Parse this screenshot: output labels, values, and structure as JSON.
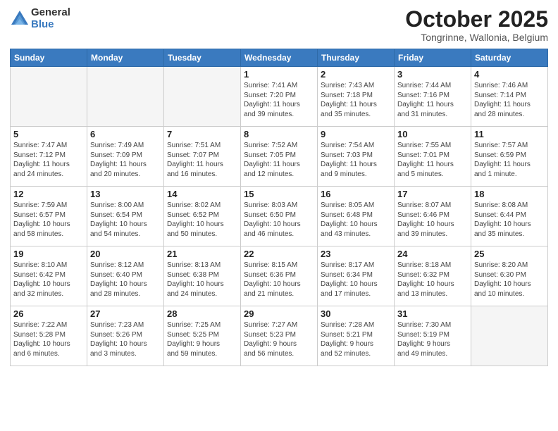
{
  "logo": {
    "general": "General",
    "blue": "Blue"
  },
  "header": {
    "title": "October 2025",
    "location": "Tongrinne, Wallonia, Belgium"
  },
  "weekdays": [
    "Sunday",
    "Monday",
    "Tuesday",
    "Wednesday",
    "Thursday",
    "Friday",
    "Saturday"
  ],
  "weeks": [
    [
      {
        "day": "",
        "info": ""
      },
      {
        "day": "",
        "info": ""
      },
      {
        "day": "",
        "info": ""
      },
      {
        "day": "1",
        "info": "Sunrise: 7:41 AM\nSunset: 7:20 PM\nDaylight: 11 hours\nand 39 minutes."
      },
      {
        "day": "2",
        "info": "Sunrise: 7:43 AM\nSunset: 7:18 PM\nDaylight: 11 hours\nand 35 minutes."
      },
      {
        "day": "3",
        "info": "Sunrise: 7:44 AM\nSunset: 7:16 PM\nDaylight: 11 hours\nand 31 minutes."
      },
      {
        "day": "4",
        "info": "Sunrise: 7:46 AM\nSunset: 7:14 PM\nDaylight: 11 hours\nand 28 minutes."
      }
    ],
    [
      {
        "day": "5",
        "info": "Sunrise: 7:47 AM\nSunset: 7:12 PM\nDaylight: 11 hours\nand 24 minutes."
      },
      {
        "day": "6",
        "info": "Sunrise: 7:49 AM\nSunset: 7:09 PM\nDaylight: 11 hours\nand 20 minutes."
      },
      {
        "day": "7",
        "info": "Sunrise: 7:51 AM\nSunset: 7:07 PM\nDaylight: 11 hours\nand 16 minutes."
      },
      {
        "day": "8",
        "info": "Sunrise: 7:52 AM\nSunset: 7:05 PM\nDaylight: 11 hours\nand 12 minutes."
      },
      {
        "day": "9",
        "info": "Sunrise: 7:54 AM\nSunset: 7:03 PM\nDaylight: 11 hours\nand 9 minutes."
      },
      {
        "day": "10",
        "info": "Sunrise: 7:55 AM\nSunset: 7:01 PM\nDaylight: 11 hours\nand 5 minutes."
      },
      {
        "day": "11",
        "info": "Sunrise: 7:57 AM\nSunset: 6:59 PM\nDaylight: 11 hours\nand 1 minute."
      }
    ],
    [
      {
        "day": "12",
        "info": "Sunrise: 7:59 AM\nSunset: 6:57 PM\nDaylight: 10 hours\nand 58 minutes."
      },
      {
        "day": "13",
        "info": "Sunrise: 8:00 AM\nSunset: 6:54 PM\nDaylight: 10 hours\nand 54 minutes."
      },
      {
        "day": "14",
        "info": "Sunrise: 8:02 AM\nSunset: 6:52 PM\nDaylight: 10 hours\nand 50 minutes."
      },
      {
        "day": "15",
        "info": "Sunrise: 8:03 AM\nSunset: 6:50 PM\nDaylight: 10 hours\nand 46 minutes."
      },
      {
        "day": "16",
        "info": "Sunrise: 8:05 AM\nSunset: 6:48 PM\nDaylight: 10 hours\nand 43 minutes."
      },
      {
        "day": "17",
        "info": "Sunrise: 8:07 AM\nSunset: 6:46 PM\nDaylight: 10 hours\nand 39 minutes."
      },
      {
        "day": "18",
        "info": "Sunrise: 8:08 AM\nSunset: 6:44 PM\nDaylight: 10 hours\nand 35 minutes."
      }
    ],
    [
      {
        "day": "19",
        "info": "Sunrise: 8:10 AM\nSunset: 6:42 PM\nDaylight: 10 hours\nand 32 minutes."
      },
      {
        "day": "20",
        "info": "Sunrise: 8:12 AM\nSunset: 6:40 PM\nDaylight: 10 hours\nand 28 minutes."
      },
      {
        "day": "21",
        "info": "Sunrise: 8:13 AM\nSunset: 6:38 PM\nDaylight: 10 hours\nand 24 minutes."
      },
      {
        "day": "22",
        "info": "Sunrise: 8:15 AM\nSunset: 6:36 PM\nDaylight: 10 hours\nand 21 minutes."
      },
      {
        "day": "23",
        "info": "Sunrise: 8:17 AM\nSunset: 6:34 PM\nDaylight: 10 hours\nand 17 minutes."
      },
      {
        "day": "24",
        "info": "Sunrise: 8:18 AM\nSunset: 6:32 PM\nDaylight: 10 hours\nand 13 minutes."
      },
      {
        "day": "25",
        "info": "Sunrise: 8:20 AM\nSunset: 6:30 PM\nDaylight: 10 hours\nand 10 minutes."
      }
    ],
    [
      {
        "day": "26",
        "info": "Sunrise: 7:22 AM\nSunset: 5:28 PM\nDaylight: 10 hours\nand 6 minutes."
      },
      {
        "day": "27",
        "info": "Sunrise: 7:23 AM\nSunset: 5:26 PM\nDaylight: 10 hours\nand 3 minutes."
      },
      {
        "day": "28",
        "info": "Sunrise: 7:25 AM\nSunset: 5:25 PM\nDaylight: 9 hours\nand 59 minutes."
      },
      {
        "day": "29",
        "info": "Sunrise: 7:27 AM\nSunset: 5:23 PM\nDaylight: 9 hours\nand 56 minutes."
      },
      {
        "day": "30",
        "info": "Sunrise: 7:28 AM\nSunset: 5:21 PM\nDaylight: 9 hours\nand 52 minutes."
      },
      {
        "day": "31",
        "info": "Sunrise: 7:30 AM\nSunset: 5:19 PM\nDaylight: 9 hours\nand 49 minutes."
      },
      {
        "day": "",
        "info": ""
      }
    ]
  ]
}
